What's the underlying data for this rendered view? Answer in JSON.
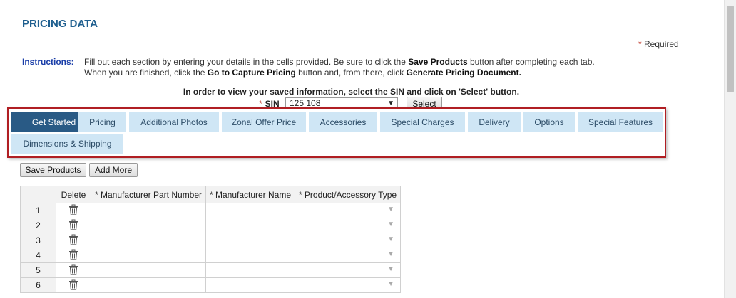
{
  "page": {
    "title": "PRICING DATA"
  },
  "required_note": {
    "star": "*",
    "text": "Required"
  },
  "instructions": {
    "label": "Instructions:",
    "line1_pre": "Fill out each section by entering your details in the cells provided. Be sure to click the ",
    "line1_bold": "Save Products",
    "line1_post": " button after completing each tab.",
    "line2_pre": "When you are finished, click the ",
    "line2_bold1": "Go to Capture Pricing",
    "line2_mid": " button and, from there, click ",
    "line2_bold2": "Generate Pricing Document."
  },
  "sin": {
    "instruction": "In order to view your saved information, select the SIN and click on 'Select' button.",
    "star": "*",
    "label": "SIN",
    "selected": "125 108",
    "select_button": "Select"
  },
  "tabs": [
    {
      "label": "Get Started",
      "active": true
    },
    {
      "label": "Pricing",
      "active": false
    },
    {
      "label": "Additional Photos",
      "active": false
    },
    {
      "label": "Zonal Offer Price",
      "active": false
    },
    {
      "label": "Accessories",
      "active": false
    },
    {
      "label": "Special Charges",
      "active": false
    },
    {
      "label": "Delivery",
      "active": false
    },
    {
      "label": "Options",
      "active": false
    },
    {
      "label": "Special Features",
      "active": false
    },
    {
      "label": "Dimensions & Shipping",
      "active": false
    }
  ],
  "toolbar": {
    "save_label": "Save Products",
    "add_label": "Add More"
  },
  "grid": {
    "columns": [
      "Delete",
      "* Manufacturer Part Number",
      "* Manufacturer Name",
      "* Product/Accessory Type"
    ],
    "rows": [
      "1",
      "2",
      "3",
      "4",
      "5",
      "6"
    ]
  },
  "icons": {
    "delete": "trash-icon",
    "dropdown": "chevron-down-icon"
  },
  "colors": {
    "accent": "#1f5f8f",
    "tab_active": "#295a85",
    "tab_inactive": "#cfe6f5",
    "frame": "#b01e23"
  }
}
